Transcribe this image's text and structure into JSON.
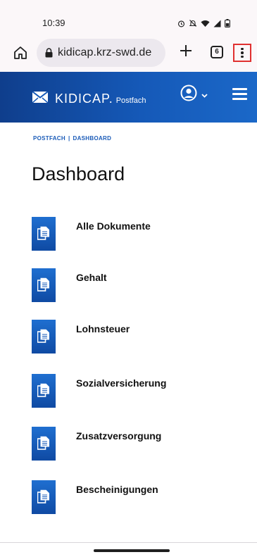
{
  "status_bar": {
    "time": "10:39",
    "icons": [
      "alarm-icon",
      "mute-icon",
      "wifi-icon",
      "signal-icon",
      "battery-icon"
    ]
  },
  "browser": {
    "url": "kidicap.krz-swd.de",
    "tab_count": "6",
    "menu_highlight_color": "#e03030"
  },
  "header": {
    "logo_text": "KIDICAP.",
    "logo_sub": "Postfach",
    "brand_color": "#1559b8"
  },
  "breadcrumb": {
    "items": [
      "POSTFACH",
      "DASHBOARD"
    ],
    "separator": "|"
  },
  "page": {
    "title": "Dashboard"
  },
  "documents": [
    {
      "label": "Alle Dokumente"
    },
    {
      "label": "Gehalt"
    },
    {
      "label": "Lohnsteuer"
    },
    {
      "label": "Sozialversicherung"
    },
    {
      "label": "Zusatzversorgung"
    },
    {
      "label": "Bescheinigungen"
    }
  ]
}
